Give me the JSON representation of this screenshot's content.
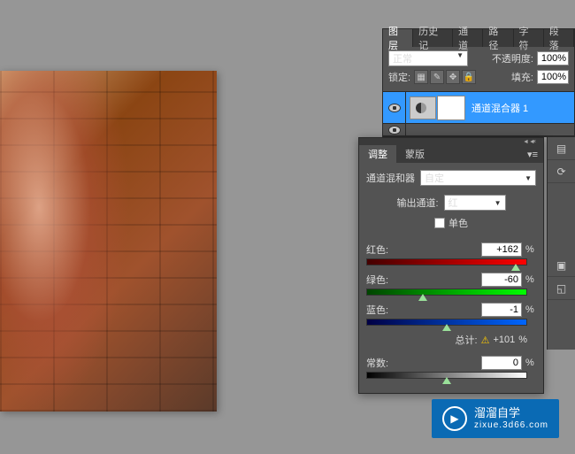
{
  "layers_panel": {
    "tabs": [
      "图层",
      "历史记",
      "通道",
      "路径",
      "字符",
      "段落"
    ],
    "active_tab": 0,
    "blend_mode": "正常",
    "opacity_label": "不透明度:",
    "opacity_value": "100%",
    "lock_label": "锁定:",
    "fill_label": "填充:",
    "fill_value": "100%",
    "layer_name": "通道混合器 1"
  },
  "adj_panel": {
    "tabs": [
      "调整",
      "蒙版"
    ],
    "active_tab": 0,
    "title": "通道混和器",
    "preset": "自定",
    "output_label": "输出通道:",
    "output_value": "红",
    "mono_label": "单色",
    "sliders": {
      "red": {
        "label": "红色:",
        "value": "+162"
      },
      "green": {
        "label": "绿色:",
        "value": "-60"
      },
      "blue": {
        "label": "蓝色:",
        "value": "-1"
      },
      "constant": {
        "label": "常数:",
        "value": "0"
      }
    },
    "total_label": "总计:",
    "total_value": "+101",
    "pct": "%"
  },
  "watermark": {
    "title": "溜溜自学",
    "sub": "zixue.3d66.com"
  }
}
